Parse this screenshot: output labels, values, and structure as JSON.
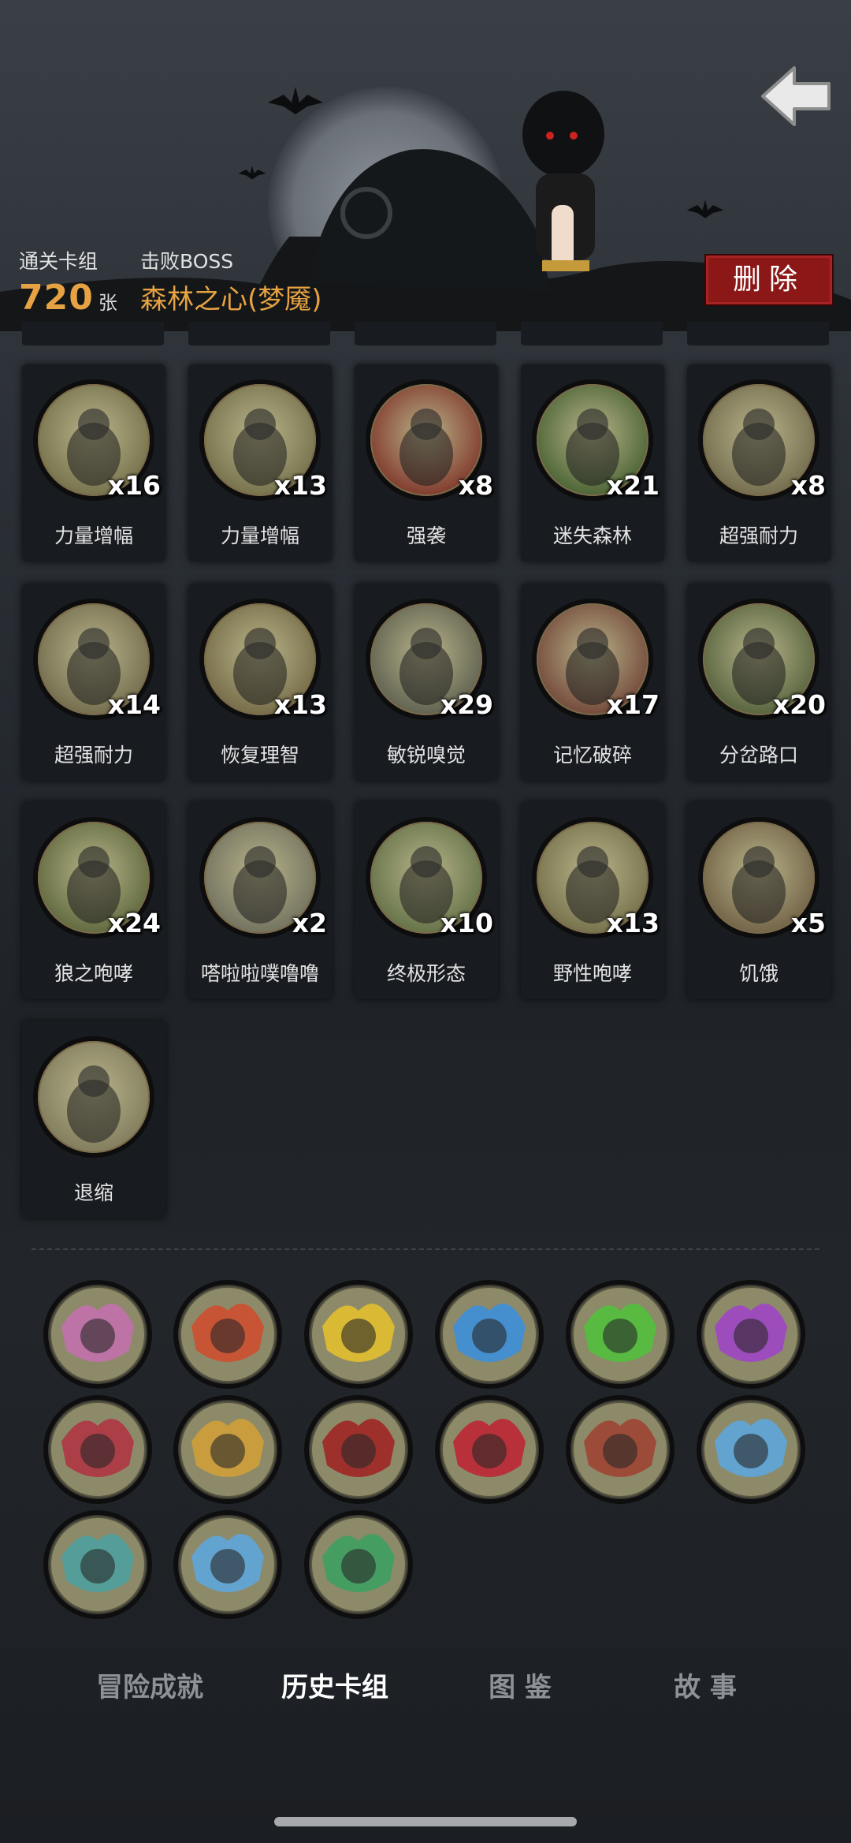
{
  "header": {
    "cleared_decks_label": "通关卡组",
    "cleared_count": "720",
    "cleared_unit": "张",
    "boss_label": "击败BOSS",
    "boss_name": "森林之心(梦魇)",
    "delete_label": "删除"
  },
  "cards": [
    {
      "name": "力量增幅",
      "qty": "x16",
      "icon": "log-kid-icon",
      "tint": "#6e6a45"
    },
    {
      "name": "力量增幅",
      "qty": "x13",
      "icon": "log-kid-icon",
      "tint": "#6e6a45"
    },
    {
      "name": "强袭",
      "qty": "x8",
      "icon": "werewolf-attack-icon",
      "tint": "#7a2a20"
    },
    {
      "name": "迷失森林",
      "qty": "x21",
      "icon": "lost-forest-icon",
      "tint": "#3d5a2a"
    },
    {
      "name": "超强耐力",
      "qty": "x8",
      "icon": "endurance-icon",
      "tint": "#6b6548"
    },
    {
      "name": "超强耐力",
      "qty": "x14",
      "icon": "endurance-icon",
      "tint": "#6b6548"
    },
    {
      "name": "恢复理智",
      "qty": "x13",
      "icon": "sanity-icon",
      "tint": "#6e6440"
    },
    {
      "name": "敏锐嗅觉",
      "qty": "x29",
      "icon": "wolf-head-icon",
      "tint": "#55584a"
    },
    {
      "name": "记忆破碎",
      "qty": "x17",
      "icon": "shattered-memory-icon",
      "tint": "#6a3b30"
    },
    {
      "name": "分岔路口",
      "qty": "x20",
      "icon": "crossroads-icon",
      "tint": "#4a5a35"
    },
    {
      "name": "狼之咆哮",
      "qty": "x24",
      "icon": "wolf-roar-icon",
      "tint": "#556035"
    },
    {
      "name": "嗒啦啦噗噜噜",
      "qty": "x2",
      "icon": "robot-girl-icon",
      "tint": "#6a6a5a"
    },
    {
      "name": "终极形态",
      "qty": "x10",
      "icon": "ultimate-form-icon",
      "tint": "#5a6a40"
    },
    {
      "name": "野性咆哮",
      "qty": "x13",
      "icon": "howl-moon-icon",
      "tint": "#6e6a45"
    },
    {
      "name": "饥饿",
      "qty": "x5",
      "icon": "hunger-beast-icon",
      "tint": "#6a5a40"
    },
    {
      "name": "退缩",
      "qty": "",
      "icon": "retreat-icon",
      "tint": "#7a7658"
    }
  ],
  "achievements": [
    {
      "icon": "tentacle-icon",
      "color": "#c56fb0"
    },
    {
      "icon": "zombie-music-red-icon",
      "color": "#d14a2a"
    },
    {
      "icon": "zombie-music-yellow-icon",
      "color": "#e7c12a"
    },
    {
      "icon": "zombie-music-blue-icon",
      "color": "#3a8fe0"
    },
    {
      "icon": "zombie-music-green-icon",
      "color": "#4fc23a"
    },
    {
      "icon": "zombie-music-purple-icon",
      "color": "#a042c9"
    },
    {
      "icon": "vip-gift-icon",
      "color": "#b03040"
    },
    {
      "icon": "treasure-gold-icon",
      "color": "#d4a035"
    },
    {
      "icon": "bloody-hand-icon",
      "color": "#a02020"
    },
    {
      "icon": "red-book-icon",
      "color": "#c02030"
    },
    {
      "icon": "hooded-girl-icon",
      "color": "#a04030"
    },
    {
      "icon": "frozen-clock-icon",
      "color": "#5aa8e0"
    },
    {
      "icon": "hand-cards-icon",
      "color": "#4aa0a0"
    },
    {
      "icon": "frozen-clock-icon",
      "color": "#5aa8e0"
    },
    {
      "icon": "werewolf-dna-icon",
      "color": "#3aa060"
    }
  ],
  "tabs": [
    {
      "label": "冒险成就",
      "active": false
    },
    {
      "label": "历史卡组",
      "active": true
    },
    {
      "label": "图 鉴",
      "active": false
    },
    {
      "label": "故 事",
      "active": false
    }
  ]
}
